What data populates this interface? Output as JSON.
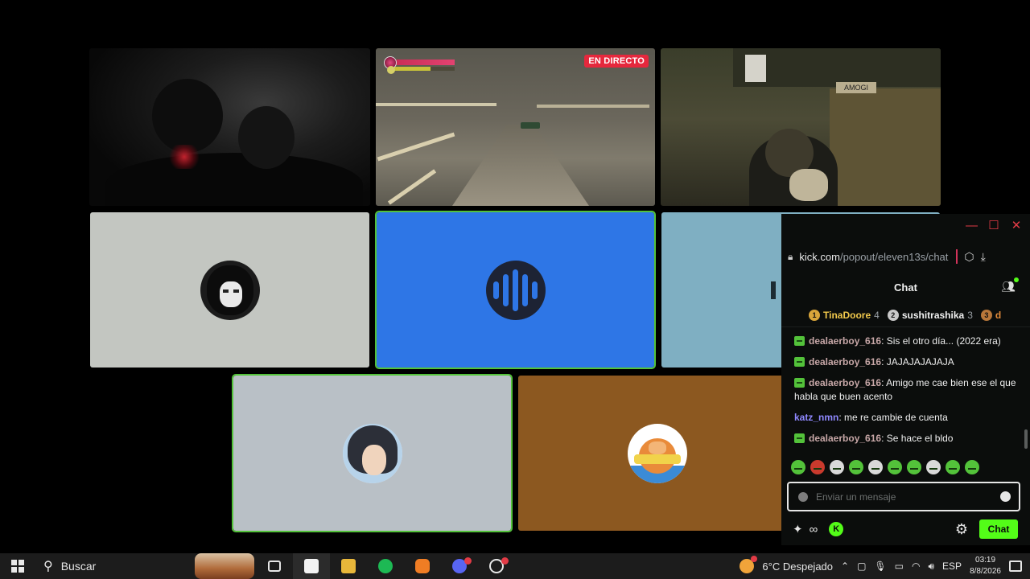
{
  "stage": {
    "live_badge": "EN DIRECTO",
    "game_hud": {
      "health": 0.85,
      "mana": 0.6
    },
    "room_sign": "AMOGI"
  },
  "chat": {
    "url_host": "kick.com",
    "url_path": "/popout/eleven13s/chat",
    "title": "Chat",
    "leaders": [
      {
        "rank": "1",
        "name": "TinaDoore",
        "count": "4",
        "color": "#f2c94c",
        "medal_color": "#d9a53a"
      },
      {
        "rank": "2",
        "name": "sushitrashika",
        "count": "3",
        "color": "#f1f1f1",
        "medal_color": "#c9c9c9"
      },
      {
        "rank": "3",
        "name": "d",
        "count": "",
        "color": "#e08a3a",
        "medal_color": "#b8773a"
      }
    ],
    "messages": [
      {
        "user": "dealaerboy_616",
        "text": "Sis el otro día... (2022 era)",
        "badge": true,
        "user_class": "u-green"
      },
      {
        "user": "dealaerboy_616",
        "text": "JAJAJAJAJAJA",
        "badge": true,
        "user_class": "u-green"
      },
      {
        "user": "dealaerboy_616",
        "text": "Amigo me cae bien ese el que habla que buen acento",
        "badge": true,
        "user_class": "u-green"
      },
      {
        "user": "katz_nmn",
        "text": "me re cambie de cuenta",
        "badge": false,
        "user_class": "u-blue"
      },
      {
        "user": "dealaerboy_616",
        "text": "Se hace el bldo",
        "badge": true,
        "user_class": "u-green"
      }
    ],
    "input_placeholder": "Enviar un mensaje",
    "send_label": "Chat",
    "k_badge": "K",
    "infinity": "∞"
  },
  "taskbar": {
    "search_label": "Buscar",
    "weather": "6°C Despejado",
    "language": "ESP",
    "time": "03:19",
    "date": "8/8/2026"
  }
}
